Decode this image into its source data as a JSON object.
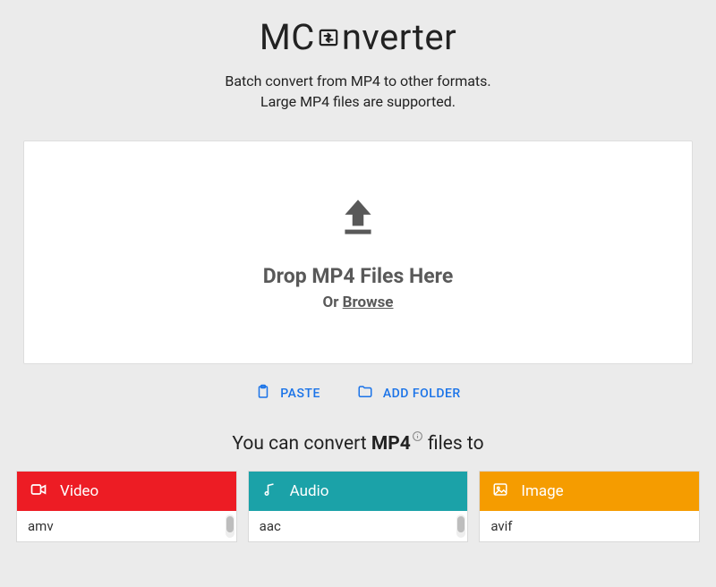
{
  "logo": {
    "pre": "MC",
    "post": "nverter"
  },
  "subtitle": {
    "line1": "Batch convert from MP4 to other formats.",
    "line2": "Large MP4 files are supported."
  },
  "dropzone": {
    "title": "Drop MP4 Files Here",
    "or": "Or ",
    "browse": "Browse"
  },
  "actions": {
    "paste": "PASTE",
    "add_folder": "ADD FOLDER"
  },
  "convert": {
    "prefix": "You can convert ",
    "format": "MP4",
    "suffix": " files to"
  },
  "categories": {
    "video": {
      "label": "Video",
      "items": [
        "amv"
      ]
    },
    "audio": {
      "label": "Audio",
      "items": [
        "aac"
      ]
    },
    "image": {
      "label": "Image",
      "items": [
        "avif"
      ]
    }
  }
}
